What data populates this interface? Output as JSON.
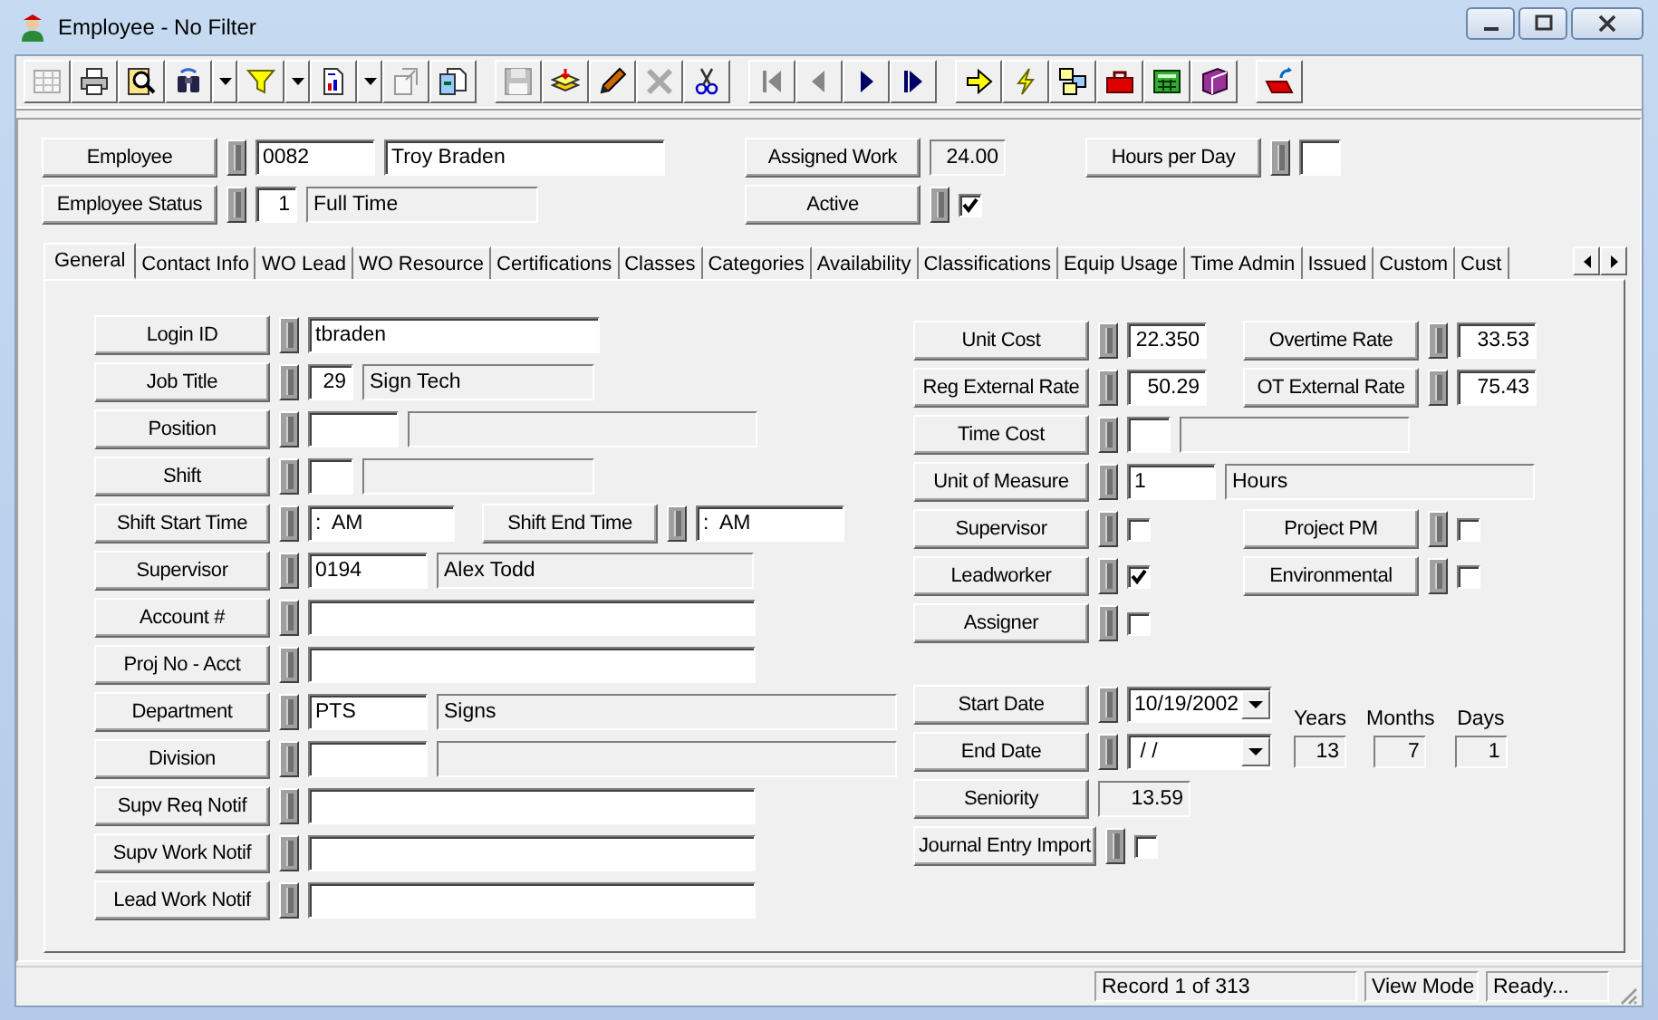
{
  "window": {
    "title": "Employee - No Filter"
  },
  "toolbar": [
    [
      {
        "disabled": true,
        "dropdown": false
      },
      {
        "disabled": false,
        "dropdown": false
      },
      {
        "disabled": false,
        "dropdown": false
      },
      {
        "disabled": false,
        "dropdown": true
      },
      {
        "disabled": false,
        "dropdown": true
      },
      {
        "disabled": false,
        "dropdown": true
      },
      {
        "disabled": true,
        "dropdown": false
      },
      {
        "disabled": false,
        "dropdown": false
      }
    ],
    [
      {
        "disabled": true,
        "dropdown": false
      },
      {
        "disabled": false,
        "dropdown": false
      },
      {
        "disabled": false,
        "dropdown": false
      },
      {
        "disabled": true,
        "dropdown": false
      },
      {
        "disabled": false,
        "dropdown": false
      }
    ],
    [
      {
        "disabled": true,
        "dropdown": false
      },
      {
        "disabled": true,
        "dropdown": false
      },
      {
        "disabled": false,
        "dropdown": false
      },
      {
        "disabled": false,
        "dropdown": false
      }
    ],
    [
      {
        "disabled": false,
        "dropdown": false
      },
      {
        "disabled": false,
        "dropdown": false
      },
      {
        "disabled": false,
        "dropdown": false
      },
      {
        "disabled": false,
        "dropdown": false
      },
      {
        "disabled": false,
        "dropdown": false
      },
      {
        "disabled": false,
        "dropdown": false
      }
    ],
    [
      {
        "disabled": false,
        "dropdown": false
      }
    ]
  ],
  "header": {
    "rows": [
      [
        {
          "label": "Employee",
          "kind": "code_desc",
          "code": "0082",
          "desc": "Troy Braden"
        },
        {
          "label": "Assigned Work",
          "kind": "readonly",
          "value": "24.00"
        },
        {
          "label": "Hours per Day",
          "kind": "text"
        }
      ],
      [
        {
          "label": "Employee Status",
          "kind": "code_desc",
          "code": "1",
          "desc": "Full Time"
        },
        {
          "label": "Active",
          "kind": "check",
          "checked": true
        }
      ]
    ]
  },
  "tabs": [
    {
      "label": "General",
      "selected": true
    },
    {
      "label": "Contact Info",
      "selected": false
    },
    {
      "label": "WO Lead",
      "selected": false
    },
    {
      "label": "WO Resource",
      "selected": false
    },
    {
      "label": "Certifications",
      "selected": false
    },
    {
      "label": "Classes",
      "selected": false
    },
    {
      "label": "Categories",
      "selected": false
    },
    {
      "label": "Availability",
      "selected": false
    },
    {
      "label": "Classifications",
      "selected": false
    },
    {
      "label": "Equip Usage",
      "selected": false
    },
    {
      "label": "Time Admin",
      "selected": false
    },
    {
      "label": "Issued",
      "selected": false
    },
    {
      "label": "Custom",
      "selected": false
    },
    {
      "label": "Cust",
      "selected": false
    }
  ],
  "general": {
    "left_rows": [
      [
        {
          "label": "Login ID",
          "kind": "text",
          "value": "tbraden"
        }
      ],
      [
        {
          "label": "Job Title",
          "kind": "code_desc",
          "code": "29",
          "desc": "Sign Tech"
        }
      ],
      [
        {
          "label": "Position",
          "kind": "code_desc"
        }
      ],
      [
        {
          "label": "Shift",
          "kind": "code_desc"
        }
      ],
      [
        {
          "label": "Shift Start Time",
          "kind": "text",
          "value": ":  AM"
        },
        {
          "label": "Shift End Time",
          "kind": "text",
          "value": ":  AM"
        }
      ],
      [
        {
          "label": "Supervisor",
          "kind": "code_desc",
          "code": "0194",
          "desc": "Alex Todd"
        }
      ],
      [
        {
          "label": "Account #",
          "kind": "text"
        }
      ],
      [
        {
          "label": "Proj No - Acct",
          "kind": "text"
        }
      ],
      [
        {
          "label": "Department",
          "kind": "code_desc",
          "code": "PTS",
          "desc": "Signs"
        }
      ],
      [
        {
          "label": "Division",
          "kind": "code_desc"
        }
      ],
      [
        {
          "label": "Supv Req Notif",
          "kind": "text"
        }
      ],
      [
        {
          "label": "Supv Work Notif",
          "kind": "text"
        }
      ],
      [
        {
          "label": "Lead Work Notif",
          "kind": "text"
        }
      ]
    ],
    "right_rows": [
      [
        {
          "label": "Unit Cost",
          "kind": "text",
          "value": "22.350"
        },
        {
          "label": "Overtime Rate",
          "kind": "text",
          "value": "33.53"
        }
      ],
      [
        {
          "label": "Reg External Rate",
          "kind": "text",
          "value": "50.29"
        },
        {
          "label": "OT External Rate",
          "kind": "text",
          "value": "75.43"
        }
      ],
      [
        {
          "label": "Time Cost",
          "kind": "code_desc"
        }
      ],
      [
        {
          "label": "Unit of Measure",
          "kind": "code_desc",
          "code": "1",
          "desc": "Hours"
        }
      ],
      [
        {
          "label": "Supervisor",
          "kind": "check",
          "checked": false
        },
        {
          "label": "Project PM",
          "kind": "check",
          "checked": false
        }
      ],
      [
        {
          "label": "Leadworker",
          "kind": "check",
          "checked": true
        },
        {
          "label": "Environmental",
          "kind": "check",
          "checked": false
        }
      ],
      [
        {
          "label": "Assigner",
          "kind": "check",
          "checked": false
        }
      ],
      [
        {
          "label": "Start Date",
          "kind": "date",
          "value": "10/19/2002"
        }
      ],
      [
        {
          "label": "End Date",
          "kind": "date",
          "value": " / /"
        }
      ],
      [
        {
          "label": "Seniority",
          "kind": "readonly",
          "value": "13.59"
        }
      ],
      [
        {
          "label": "Journal Entry Import",
          "kind": "check",
          "checked": false
        }
      ]
    ],
    "seniority_breakdown": [
      {
        "label": "Years",
        "value": "13"
      },
      {
        "label": "Months",
        "value": "7"
      },
      {
        "label": "Days",
        "value": "1"
      }
    ]
  },
  "status_bar": [
    "Record 1 of 313",
    "View Mode",
    "Ready..."
  ]
}
